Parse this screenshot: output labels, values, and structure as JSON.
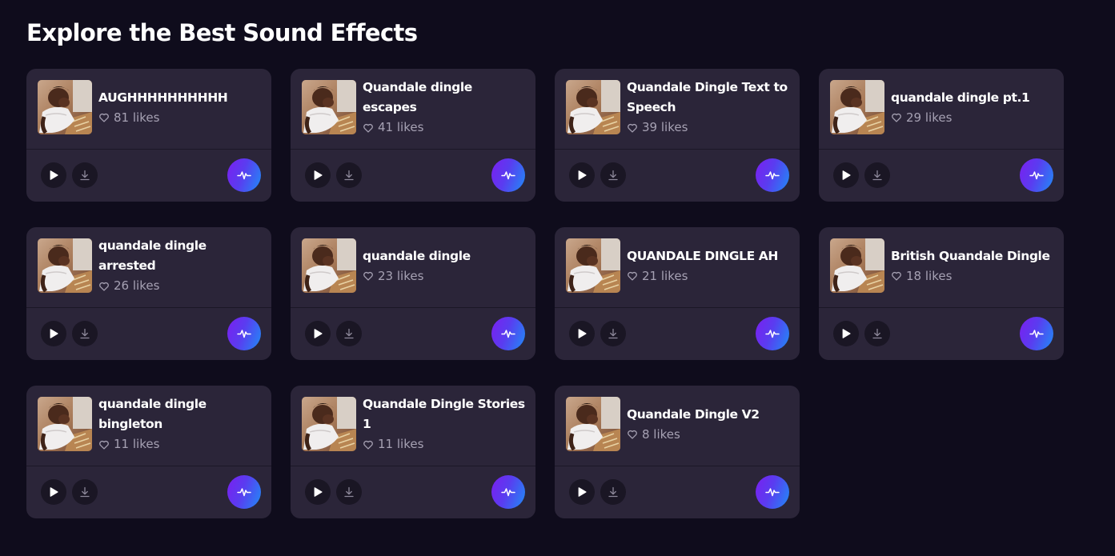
{
  "page": {
    "title": "Explore the Best Sound Effects"
  },
  "colors": {
    "background": "#0f0c1c",
    "card": "#2b2539",
    "button": "#1a1624",
    "accent_start": "#7b1ff0",
    "accent_end": "#1f8cf6",
    "muted_text": "#a6a1b3"
  },
  "icons": {
    "thumbnail": "sound-thumbnail-image",
    "likes": "heart-icon",
    "play": "play-icon",
    "download": "download-icon",
    "wave": "soundwave-icon"
  },
  "sounds": [
    {
      "name": "AUGHHHHHHHHHH",
      "likes": "81 likes"
    },
    {
      "name": "Quandale dingle escapes",
      "likes": "41 likes"
    },
    {
      "name": "Quandale Dingle Text to Speech",
      "likes": "39 likes"
    },
    {
      "name": "quandale dingle pt.1",
      "likes": "29 likes"
    },
    {
      "name": "quandale dingle arrested",
      "likes": "26 likes"
    },
    {
      "name": "quandale dingle",
      "likes": "23 likes"
    },
    {
      "name": "QUANDALE DINGLE AH",
      "likes": "21 likes"
    },
    {
      "name": "British Quandale Dingle",
      "likes": "18 likes"
    },
    {
      "name": "quandale dingle bingleton",
      "likes": "11 likes"
    },
    {
      "name": "Quandale Dingle Stories 1",
      "likes": "11 likes"
    },
    {
      "name": "Quandale Dingle V2",
      "likes": "8 likes"
    }
  ]
}
